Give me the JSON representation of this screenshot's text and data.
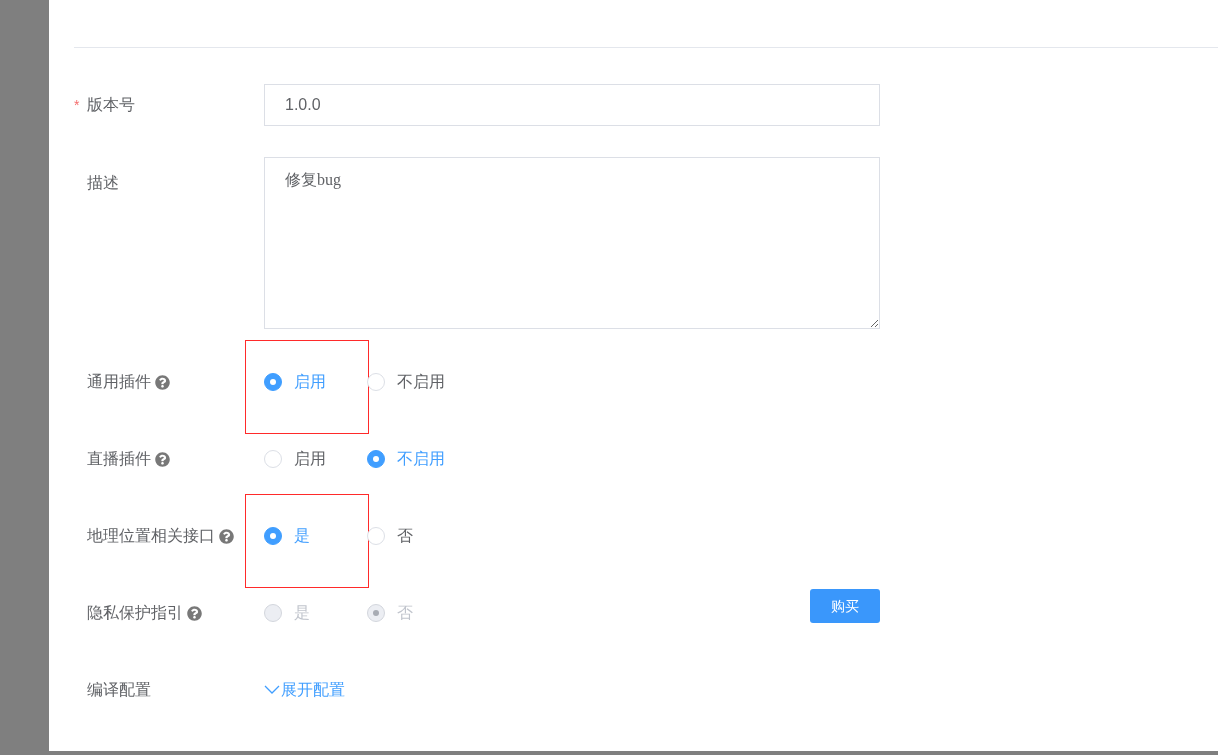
{
  "form": {
    "fields": [
      {
        "kind": "input",
        "label": "版本号",
        "required_mark": "*",
        "value": "1.0.0"
      },
      {
        "kind": "textarea",
        "label": "描述",
        "value": "修复bug"
      },
      {
        "kind": "radio",
        "label": "通用插件",
        "help": true,
        "disabled": false,
        "options": [
          {
            "label": "启用",
            "selected": true,
            "annotated": true
          },
          {
            "label": "不启用",
            "selected": false,
            "annotated": false
          }
        ]
      },
      {
        "kind": "radio",
        "label": "直播插件",
        "help": true,
        "disabled": false,
        "options": [
          {
            "label": "启用",
            "selected": false,
            "annotated": false
          },
          {
            "label": "不启用",
            "selected": true,
            "annotated": false
          }
        ]
      },
      {
        "kind": "radio",
        "label": "地理位置相关接口",
        "help": true,
        "disabled": false,
        "options": [
          {
            "label": "是",
            "selected": true,
            "annotated": true
          },
          {
            "label": "否",
            "selected": false,
            "annotated": false
          }
        ]
      },
      {
        "kind": "radio",
        "label": "隐私保护指引",
        "help": true,
        "disabled": true,
        "options": [
          {
            "label": "是",
            "selected": false,
            "annotated": false
          },
          {
            "label": "否",
            "selected": true,
            "annotated": false
          }
        ],
        "button": "购买"
      },
      {
        "kind": "link",
        "label": "编译配置",
        "link": "展开配置"
      }
    ]
  }
}
